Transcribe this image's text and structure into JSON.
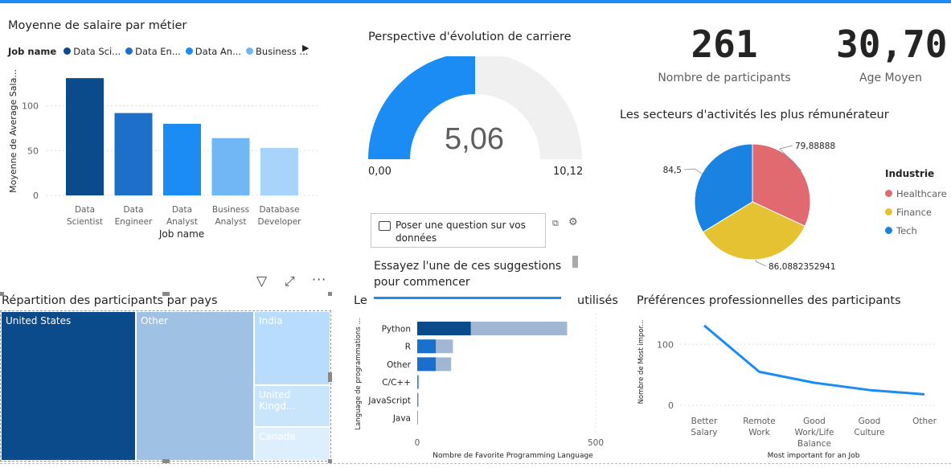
{
  "salary_chart": {
    "title": "Moyenne de salaire par métier",
    "legend_label": "Job name",
    "legend_items": [
      {
        "label": "Data Sci...",
        "color": "#0b4a8b"
      },
      {
        "label": "Data En...",
        "color": "#1d6fc7"
      },
      {
        "label": "Data An...",
        "color": "#1a8cf3"
      },
      {
        "label": "Business ...",
        "color": "#6fb8f5"
      }
    ],
    "ylabel": "Moyenne de Average Sala...",
    "xlabel": "Job name"
  },
  "gauge": {
    "title": "Perspective d'évolution de carriere",
    "value": "5,06",
    "min_label": "0,00",
    "max_label": "10,12"
  },
  "kpis": [
    {
      "value": "261",
      "label": "Nombre de participants"
    },
    {
      "value": "30,70",
      "label": "Age Moyen"
    }
  ],
  "pie": {
    "title": "Les secteurs d'activités les plus rémunérateur",
    "legend_title": "Industrie",
    "slice_labels": [
      "79,8888888888889",
      "86,08823529411765",
      "84,5"
    ]
  },
  "qa": {
    "question": "Poser une question sur vos données",
    "suggestion": "Essayez l'une de ces suggestions pour commencer"
  },
  "treemap": {
    "title": "Répartition des participants par pays",
    "cells": [
      "United States",
      "Other",
      "India",
      "United Kingd...",
      "Canada"
    ]
  },
  "lang_chart": {
    "title_left": "Le",
    "title_right": "utilisés",
    "ylabel": "Language de programmations ...",
    "xlabel": "Nombre de Favorite Programming Language"
  },
  "pref_chart": {
    "title": "Préférences professionnelles des participants",
    "ylabel": "Nombre de Most impor...",
    "xlabel": "Most important for an Job"
  },
  "chart_data": [
    {
      "type": "bar",
      "title": "Moyenne de salaire par métier",
      "categories": [
        "Data Scientist",
        "Data Engineer",
        "Data Analyst",
        "Business Analyst",
        "Database Developer"
      ],
      "values": [
        131,
        92,
        80,
        64,
        53
      ],
      "colors": [
        "#0b4a8b",
        "#1d6fc7",
        "#1a8cf3",
        "#6fb8f5",
        "#a8d3fa"
      ],
      "ylim": [
        0,
        150
      ],
      "yticks": [
        0,
        50,
        100
      ],
      "xlabel": "Job name",
      "ylabel": "Moyenne de Average Sala...",
      "grid": true
    },
    {
      "type": "pie",
      "title": "Les secteurs d'activités les plus rémunérateur",
      "series": [
        {
          "name": "Healthcare",
          "value": 79.8888888888889,
          "label": "79,8888888888889",
          "color": "#e06a70"
        },
        {
          "name": "Finance",
          "value": 86.08823529411765,
          "label": "86,08823529411765",
          "color": "#e4c232"
        },
        {
          "name": "Tech",
          "value": 84.5,
          "label": "84,5",
          "color": "#1a82e0"
        }
      ],
      "legend_placement": "right"
    },
    {
      "type": "bar",
      "orientation": "horizontal",
      "categories": [
        "Python",
        "R",
        "Other",
        "C/C++",
        "JavaScript",
        "Java"
      ],
      "series": [
        {
          "values": [
            150,
            52,
            52,
            3,
            2,
            1
          ],
          "color": "#0b4a8b"
        },
        {
          "values": [
            420,
            100,
            95,
            5,
            4,
            2
          ],
          "color": "#a0b6d2"
        }
      ],
      "xlim": [
        0,
        500
      ],
      "xticks": [
        0,
        500
      ],
      "xlabel": "Nombre de Favorite Programming Language",
      "ylabel": "Language de programmations ...",
      "grid": true
    },
    {
      "type": "line",
      "title": "Préférences professionnelles des participants",
      "categories": [
        "Better Salary",
        "Remote Work",
        "Good Work/Life Balance",
        "Good Culture",
        "Other"
      ],
      "values": [
        131,
        55,
        37,
        25,
        18
      ],
      "ylim": [
        0,
        140
      ],
      "yticks": [
        0,
        100
      ],
      "xlabel": "Most important for an Job",
      "ylabel": "Nombre de Most impor...",
      "color": "#1a8cf3",
      "grid": true
    }
  ]
}
